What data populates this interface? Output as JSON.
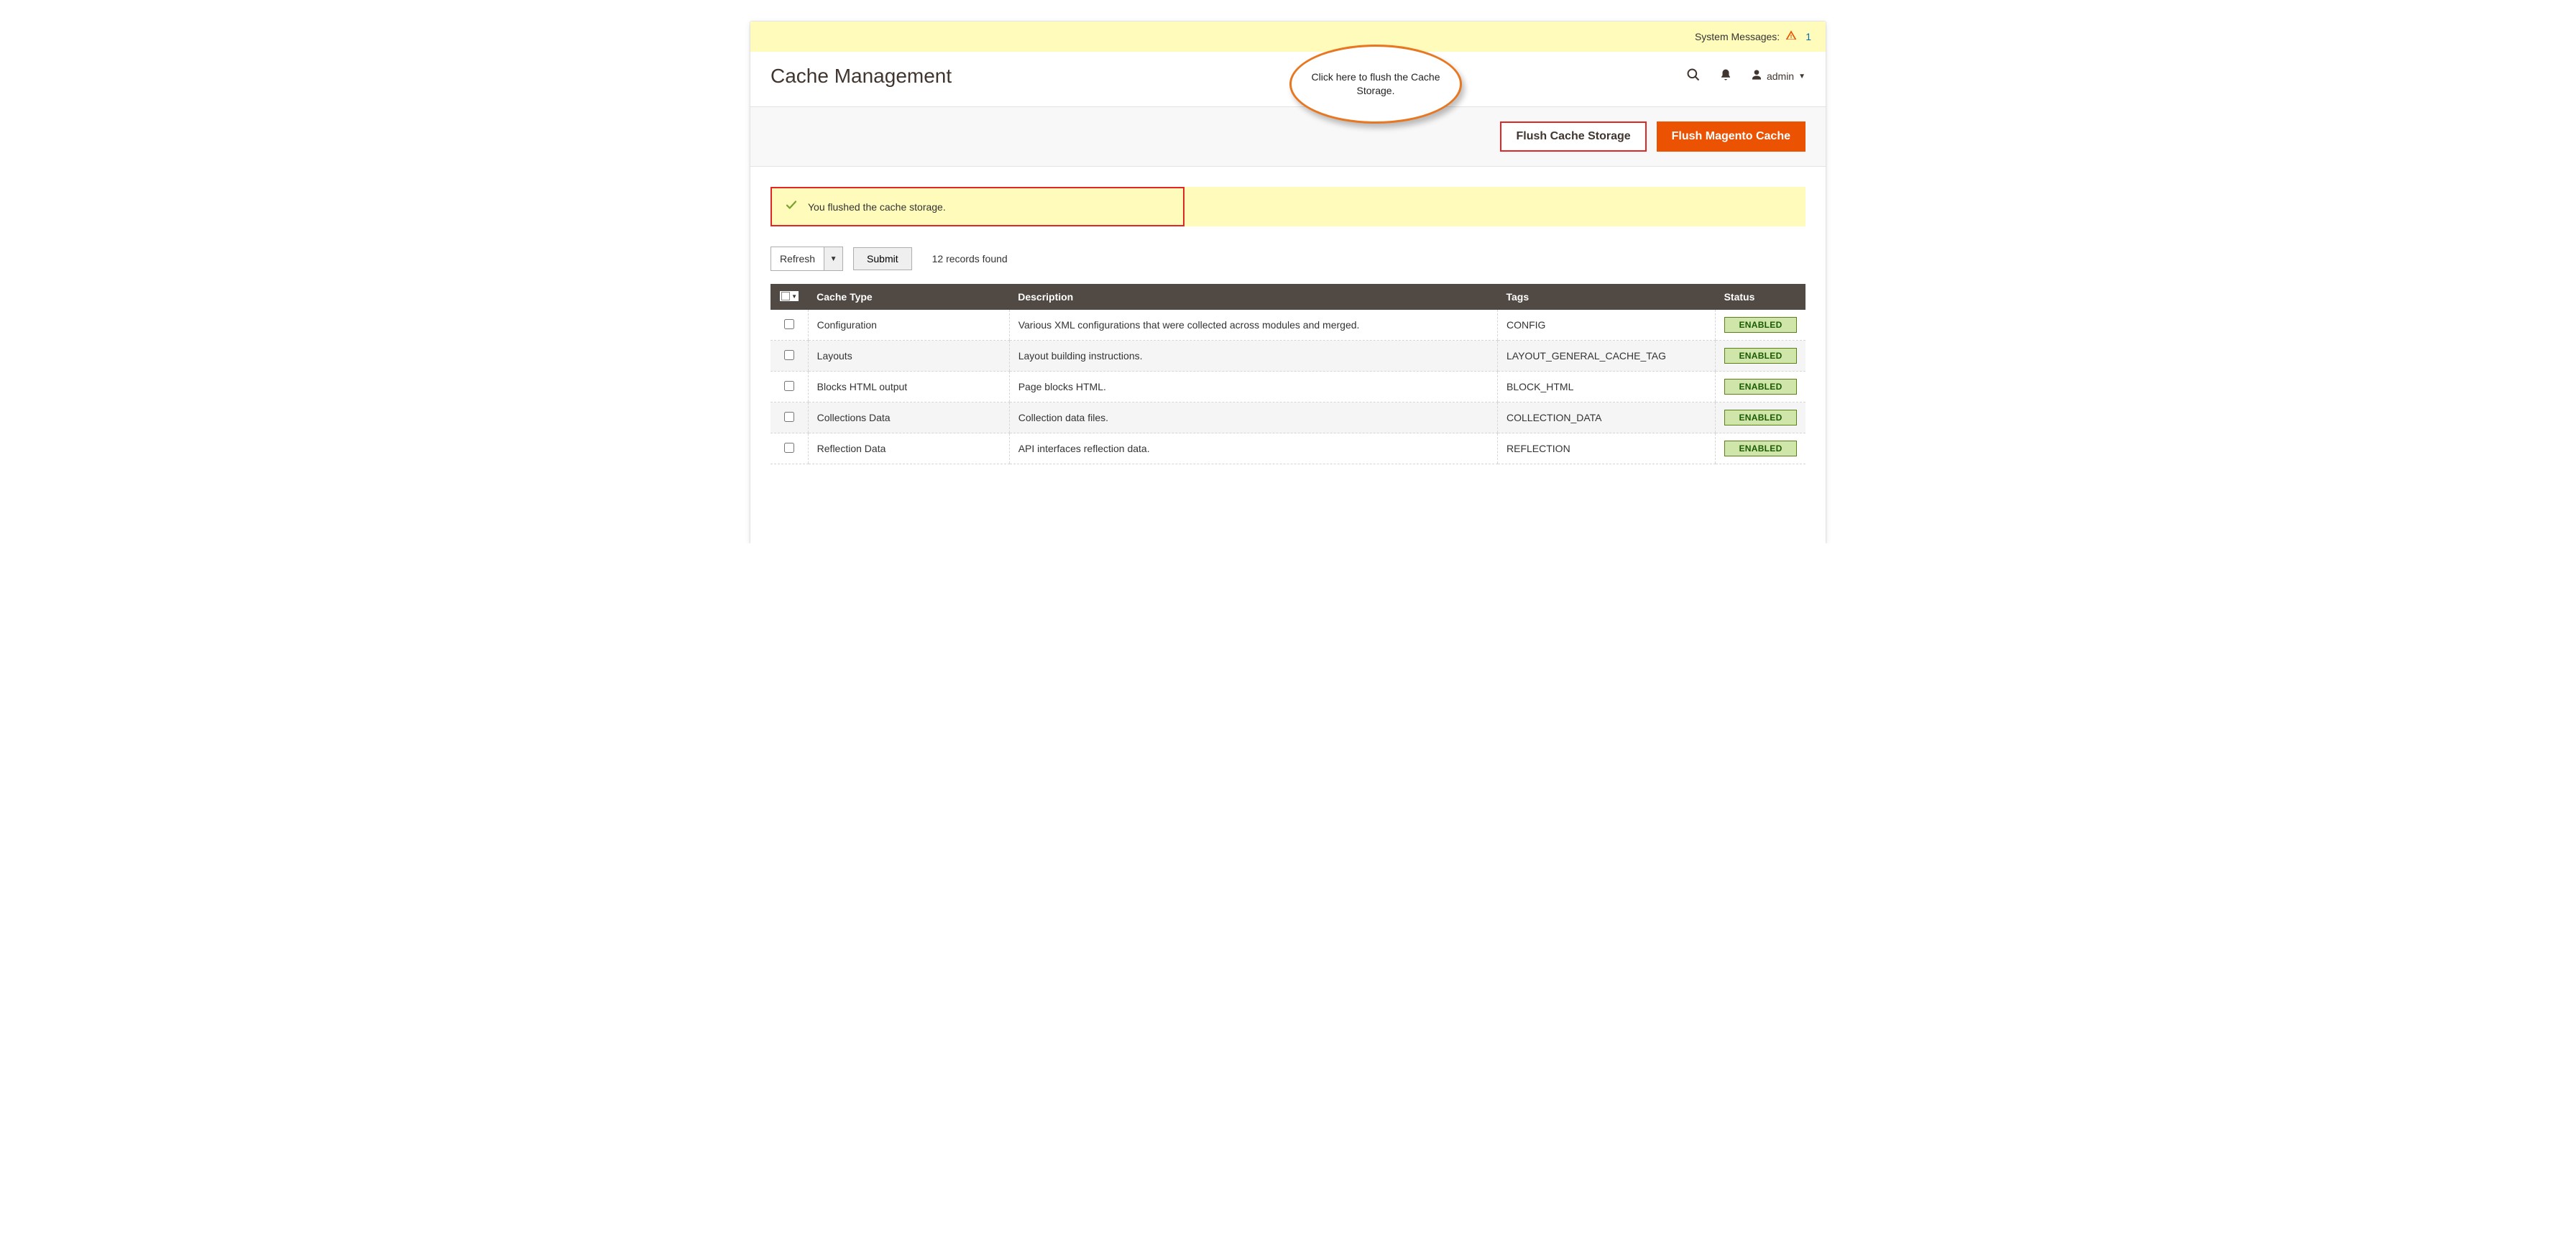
{
  "sysmsg": {
    "label": "System Messages:",
    "count": "1"
  },
  "header": {
    "title": "Cache Management",
    "admin": "admin"
  },
  "actions": {
    "flush_storage": "Flush Cache Storage",
    "flush_magento": "Flush Magento Cache"
  },
  "success": {
    "text": "You flushed the cache storage."
  },
  "toolbar": {
    "refresh": "Refresh",
    "submit": "Submit",
    "records": "12 records found"
  },
  "table": {
    "headers": {
      "type": "Cache Type",
      "desc": "Description",
      "tags": "Tags",
      "status": "Status"
    },
    "rows": [
      {
        "type": "Configuration",
        "desc": "Various XML configurations that were collected across modules and merged.",
        "tags": "CONFIG",
        "status": "ENABLED"
      },
      {
        "type": "Layouts",
        "desc": "Layout building instructions.",
        "tags": "LAYOUT_GENERAL_CACHE_TAG",
        "status": "ENABLED"
      },
      {
        "type": "Blocks HTML output",
        "desc": "Page blocks HTML.",
        "tags": "BLOCK_HTML",
        "status": "ENABLED"
      },
      {
        "type": "Collections Data",
        "desc": "Collection data files.",
        "tags": "COLLECTION_DATA",
        "status": "ENABLED"
      },
      {
        "type": "Reflection Data",
        "desc": "API interfaces reflection data.",
        "tags": "REFLECTION",
        "status": "ENABLED"
      }
    ]
  },
  "callout": {
    "text": "Click here to flush the Cache Storage."
  }
}
